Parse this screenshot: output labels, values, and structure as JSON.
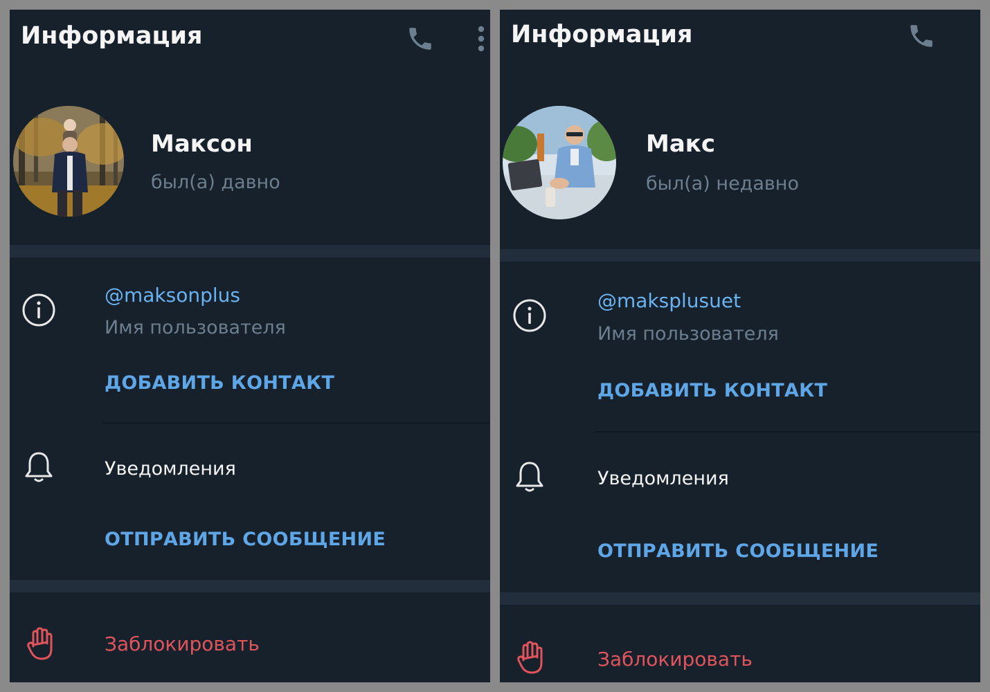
{
  "panels": [
    {
      "title": "Информация",
      "name": "Максон",
      "status": "был(а) давно",
      "username": "@maksonplus",
      "username_label": "Имя пользователя",
      "add_contact": "ДОБАВИТЬ КОНТАКТ",
      "notifications": "Уведомления",
      "send_message": "ОТПРАВИТЬ СООБЩЕНИЕ",
      "block": "Заблокировать"
    },
    {
      "title": "Информация",
      "name": "Макс",
      "status": "был(а) недавно",
      "username": "@maksplusuet",
      "username_label": "Имя пользователя",
      "add_contact": "ДОБАВИТЬ КОНТАКТ",
      "notifications": "Уведомления",
      "send_message": "ОТПРАВИТЬ СООБЩЕНИЕ",
      "block": "Заблокировать"
    }
  ],
  "icons": {
    "call": "phone-icon",
    "menu": "more-vertical-icon",
    "info": "info-circle-icon",
    "notifications": "bell-icon",
    "block": "hand-stop-icon"
  },
  "colors": {
    "background": "#17212b",
    "separator": "#232e3c",
    "accent": "#5ea6e6",
    "username": "#6ab3f3",
    "secondary_text": "#6d7f8f",
    "danger": "#e0545c",
    "frame": "#8a8a8a"
  }
}
